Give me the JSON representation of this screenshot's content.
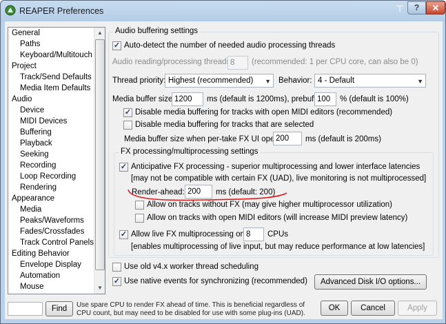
{
  "window": {
    "title": "REAPER Preferences",
    "help": "?",
    "close": "✕",
    "pin": "⊤"
  },
  "tree": {
    "items": [
      {
        "label": "General",
        "child": false
      },
      {
        "label": "Paths",
        "child": true
      },
      {
        "label": "Keyboard/Multitouch",
        "child": true
      },
      {
        "label": "Project",
        "child": false
      },
      {
        "label": "Track/Send Defaults",
        "child": true
      },
      {
        "label": "Media Item Defaults",
        "child": true
      },
      {
        "label": "Audio",
        "child": false
      },
      {
        "label": "Device",
        "child": true
      },
      {
        "label": "MIDI Devices",
        "child": true
      },
      {
        "label": "Buffering",
        "child": true
      },
      {
        "label": "Playback",
        "child": true
      },
      {
        "label": "Seeking",
        "child": true
      },
      {
        "label": "Recording",
        "child": true
      },
      {
        "label": "Loop Recording",
        "child": true
      },
      {
        "label": "Rendering",
        "child": true
      },
      {
        "label": "Appearance",
        "child": false
      },
      {
        "label": "Media",
        "child": true
      },
      {
        "label": "Peaks/Waveforms",
        "child": true
      },
      {
        "label": "Fades/Crossfades",
        "child": true
      },
      {
        "label": "Track Control Panels",
        "child": true
      },
      {
        "label": "Editing Behavior",
        "child": false
      },
      {
        "label": "Envelope Display",
        "child": true
      },
      {
        "label": "Automation",
        "child": true
      },
      {
        "label": "Mouse",
        "child": true
      }
    ]
  },
  "audio_buffering": {
    "title": "Audio buffering settings",
    "auto_detect_label": "Auto-detect the number of needed audio processing threads",
    "threads_label": "Audio reading/processing threads:",
    "threads_value": "8",
    "threads_note": "(recommended: 1 per CPU core, can also be 0)",
    "priority_label": "Thread priority:",
    "priority_value": "Highest (recommended)",
    "behavior_label": "Behavior:",
    "behavior_value": "4 - Default",
    "media_buffer_label": "Media buffer size:",
    "media_buffer_value": "1200",
    "media_buffer_note": "ms (default is 1200ms), prebuffer:",
    "prebuffer_value": "100",
    "prebuffer_note": "% (default is 100%)",
    "disable_midi_label": "Disable media buffering for tracks with open MIDI editors (recommended)",
    "disable_selected_label": "Disable media buffering for tracks that are selected",
    "per_take_label": "Media buffer size when per-take FX UI open:",
    "per_take_value": "200",
    "per_take_note": "ms (default is 200ms)"
  },
  "fx": {
    "title": "FX processing/multiprocessing settings",
    "anticipative_label": "Anticipative FX processing - superior multiprocessing and lower interface latencies",
    "anticipative_note": "[may not be compatible with certain FX (UAD), live monitoring is not multiprocessed]",
    "render_ahead_label": "Render-ahead:",
    "render_ahead_value": "200",
    "render_ahead_note": "ms (default: 200)",
    "no_fx_label": "Allow on tracks without FX (may give higher multiprocessor utilization)",
    "midi_editors_label": "Allow on tracks with open MIDI editors (will increase MIDI preview latency)",
    "live_fx_label": "Allow live FX multiprocessing on:",
    "live_fx_value": "8",
    "live_fx_unit": "CPUs",
    "live_fx_note": "[enables multiprocessing of live input, but may reduce performance at low latencies]"
  },
  "misc": {
    "old_worker_label": "Use old v4.x worker thread scheduling",
    "native_events_label": "Use native events for synchronizing (recommended)",
    "advanced_button": "Advanced Disk I/O options..."
  },
  "footer": {
    "find_value": "",
    "find_button": "Find",
    "hint": "Use spare CPU to render FX ahead of time. This is beneficial regardless of CPU count, but may need to be disabled for use with some plug-ins (UAD).",
    "ok": "OK",
    "cancel": "Cancel",
    "apply": "Apply"
  },
  "colors": {
    "title_bar": "#b9d1ea",
    "annotation_red": "#d81e1e",
    "close_red": "#c8482d"
  }
}
